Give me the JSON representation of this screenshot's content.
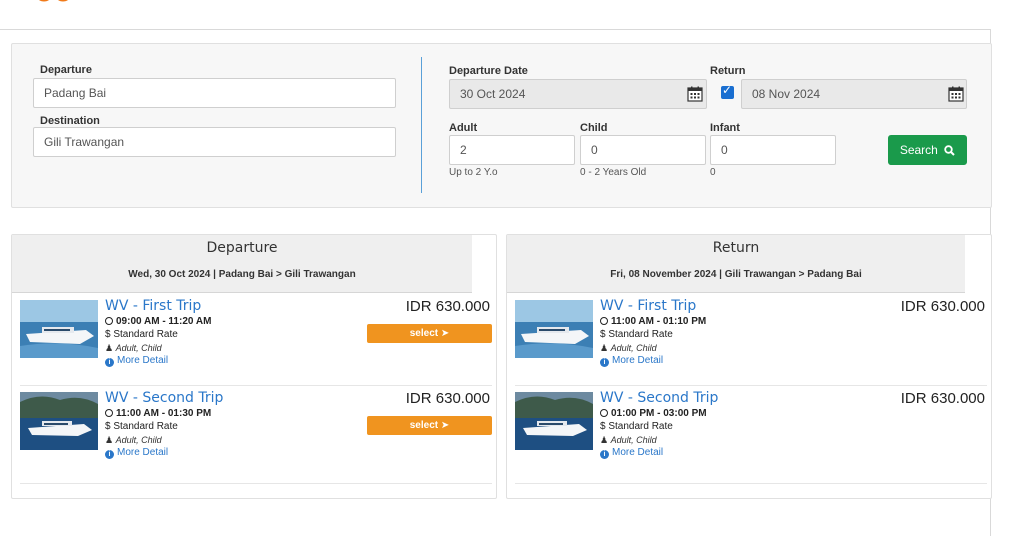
{
  "colors": {
    "accent_blue": "#2a77c9",
    "search_green": "#1a9a4b",
    "select_orange": "#f0941f",
    "logo_orange": "#f07a1a"
  },
  "search": {
    "departure_label": "Departure",
    "departure_value": "Padang Bai",
    "destination_label": "Destination",
    "destination_value": "Gili Trawangan",
    "departure_date_label": "Departure Date",
    "departure_date_value": "30 Oct 2024",
    "return_label": "Return",
    "return_checked": true,
    "return_date_value": "08 Nov 2024",
    "adult_label": "Adult",
    "adult_value": "2",
    "adult_hint": "Up to 2 Y.o",
    "child_label": "Child",
    "child_value": "0",
    "child_hint": "0 - 2 Years Old",
    "infant_label": "Infant",
    "infant_value": "0",
    "infant_hint": "0",
    "search_button": "Search",
    "calendar_icon": "calendar-icon",
    "search_icon": "search-icon"
  },
  "departure": {
    "title": "Departure",
    "subtitle": "Wed, 30 Oct 2024 |  Padang Bai  > Gili Trawangan",
    "trips": [
      {
        "name": "WV - First Trip",
        "time": "09:00 AM  -  11:20 AM",
        "rate": "Standard Rate",
        "pax": "Adult, Child",
        "more": "More Detail",
        "price": "IDR 630.000",
        "select": "select"
      },
      {
        "name": "WV - Second Trip",
        "time": "11:00 AM  -  01:30 PM",
        "rate": "Standard Rate",
        "pax": "Adult, Child",
        "more": "More Detail",
        "price": "IDR 630.000",
        "select": "select"
      }
    ]
  },
  "return": {
    "title": "Return",
    "subtitle": "Fri, 08 November 2024 |  Gili Trawangan  > Padang Bai",
    "trips": [
      {
        "name": "WV - First Trip",
        "time": "11:00 AM  -  01:10 PM",
        "rate": "Standard Rate",
        "pax": "Adult, Child",
        "more": "More Detail",
        "price": "IDR 630.000"
      },
      {
        "name": "WV - Second Trip",
        "time": "01:00 PM  -  03:00 PM",
        "rate": "Standard Rate",
        "pax": "Adult, Child",
        "more": "More Detail",
        "price": "IDR 630.000"
      }
    ]
  }
}
